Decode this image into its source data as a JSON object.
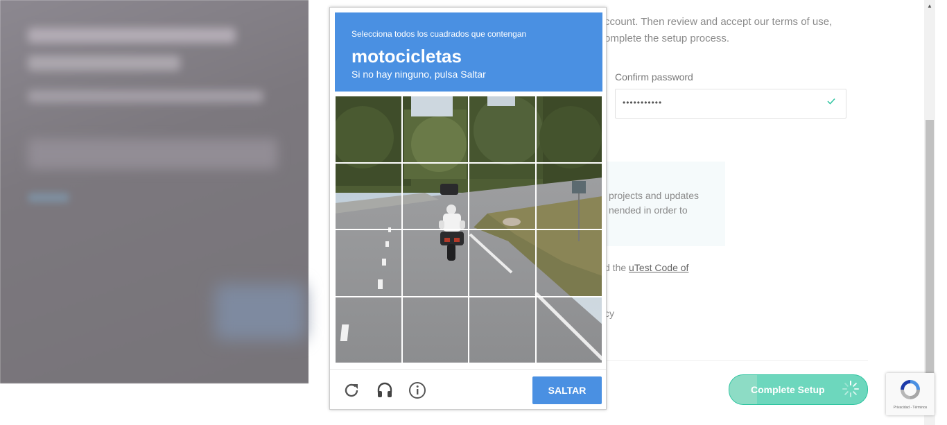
{
  "form": {
    "intro_line1": "ccount. Then review and accept our terms of use,",
    "intro_line2": "omplete the setup process.",
    "confirm_label": "Confirm password",
    "confirm_value": "•••••••••••",
    "info_line1": " projects and updates",
    "info_line2": "nended in order to",
    "terms_prefix": "d the ",
    "terms_link": "uTest Code of",
    "privacy_fragment": "cy",
    "complete_button": "Complete Setup"
  },
  "captcha": {
    "instruction": "Selecciona todos los cuadrados que contengan",
    "target": "motocicletas",
    "hint": "Si no hay ninguno, pulsa Saltar",
    "skip_label": "SALTAR",
    "icons": [
      "reload-icon",
      "audio-challenge-icon",
      "info-icon"
    ]
  },
  "recaptcha_badge": {
    "text": "Privacidad - Términos"
  },
  "colors": {
    "captcha_blue": "#4a90e2",
    "complete_green": "#6dd7bd"
  }
}
